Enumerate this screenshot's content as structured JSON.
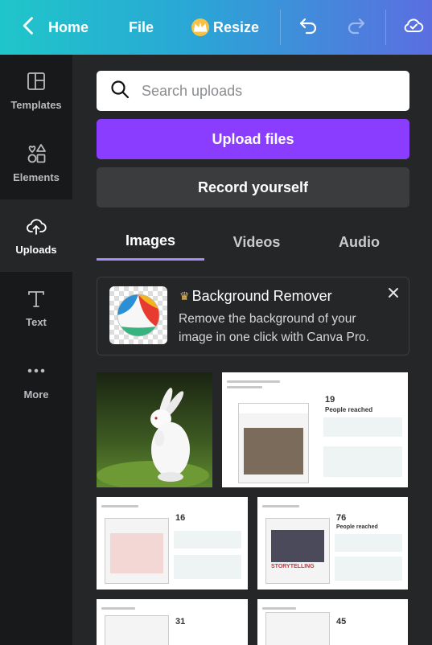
{
  "topbar": {
    "home_label": "Home",
    "file_label": "File",
    "resize_label": "Resize",
    "icons": [
      "chevron-left-icon",
      "crown-icon",
      "undo-icon",
      "redo-icon",
      "cloud-check-icon"
    ]
  },
  "rail": {
    "items": [
      {
        "label": "Templates",
        "icon": "templates-icon"
      },
      {
        "label": "Elements",
        "icon": "elements-icon"
      },
      {
        "label": "Uploads",
        "icon": "cloud-upload-icon",
        "active": true
      },
      {
        "label": "Text",
        "icon": "text-icon"
      },
      {
        "label": "More",
        "icon": "more-icon"
      }
    ]
  },
  "panel": {
    "search_placeholder": "Search uploads",
    "upload_button": "Upload files",
    "record_button": "Record yourself",
    "tabs": [
      {
        "label": "Images",
        "active": true
      },
      {
        "label": "Videos"
      },
      {
        "label": "Audio"
      }
    ],
    "promo": {
      "title": "Background Remover",
      "text": "Remove the background of your image in one click with Canva Pro."
    },
    "grid": {
      "g2_count": "19",
      "g2_reached": "People reached",
      "g3_count": "16",
      "g4_count": "76",
      "g4_reached": "People reached",
      "g4_caption": "STORYTELLING",
      "g5_count": "31",
      "g6_count": "45"
    }
  },
  "colors": {
    "accent": "#8b3dff",
    "panel_bg": "#252627",
    "rail_bg": "#18191b",
    "crown": "#f6c244"
  }
}
